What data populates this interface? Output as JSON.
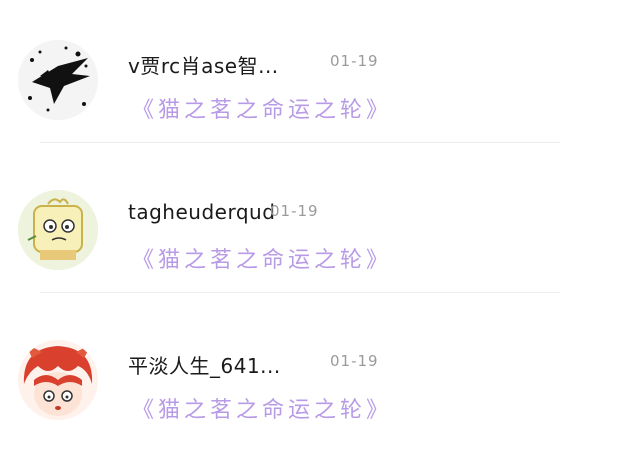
{
  "comments": [
    {
      "username": "v贾rc肖ase智...",
      "date": "01-19",
      "comic": "《猫之茗之命运之轮》",
      "avatar_icon": "black-ink-swallow-avatar"
    },
    {
      "username": "tagheuderqud",
      "date": "01-19",
      "comic": "《猫之茗之命运之轮》",
      "avatar_icon": "cartoon-tofu-character-avatar"
    },
    {
      "username": "平淡人生_641...",
      "date": "01-19",
      "comic": "《猫之茗之命运之轮》",
      "avatar_icon": "red-hair-anime-boy-avatar"
    }
  ],
  "colors": {
    "comic_link": "#b89be6",
    "date": "#9a9a9a",
    "divider": "#ededed"
  }
}
